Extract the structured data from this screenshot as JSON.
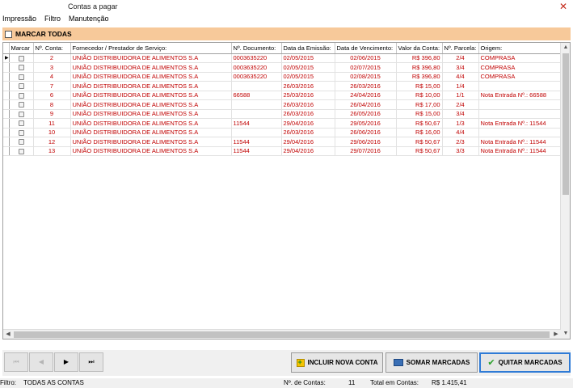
{
  "window": {
    "title": "Contas a pagar"
  },
  "menu": [
    "Impressão",
    "Filtro",
    "Manutenção"
  ],
  "marcar_todas": "MARCAR TODAS",
  "grid": {
    "columns": [
      "Marcar",
      "Nº. Conta:",
      "Fornecedor / Prestador de Serviço:",
      "Nº. Documento:",
      "Data da Emissão:",
      "Data de Vencimento:",
      "Valor da Conta:",
      "Nº. Parcela:",
      "Origem:"
    ],
    "rows": [
      {
        "conta": "2",
        "fornecedor": "UNIÃO DISTRIBUIDORA DE ALIMENTOS S.A",
        "documento": "0003635220",
        "emissao": "02/05/2015",
        "vencimento": "02/06/2015",
        "valor": "R$ 396,80",
        "parcela": "2/4",
        "origem": "COMPRASA"
      },
      {
        "conta": "3",
        "fornecedor": "UNIÃO DISTRIBUIDORA DE ALIMENTOS S.A",
        "documento": "0003635220",
        "emissao": "02/05/2015",
        "vencimento": "02/07/2015",
        "valor": "R$ 396,80",
        "parcela": "3/4",
        "origem": "COMPRASA"
      },
      {
        "conta": "4",
        "fornecedor": "UNIÃO DISTRIBUIDORA DE ALIMENTOS S.A",
        "documento": "0003635220",
        "emissao": "02/05/2015",
        "vencimento": "02/08/2015",
        "valor": "R$ 396,80",
        "parcela": "4/4",
        "origem": "COMPRASA"
      },
      {
        "conta": "7",
        "fornecedor": "UNIÃO DISTRIBUIDORA DE ALIMENTOS S.A",
        "documento": "",
        "emissao": "26/03/2016",
        "vencimento": "26/03/2016",
        "valor": "R$ 15,00",
        "parcela": "1/4",
        "origem": ""
      },
      {
        "conta": "6",
        "fornecedor": "UNIÃO DISTRIBUIDORA DE ALIMENTOS S.A",
        "documento": "66588",
        "emissao": "25/03/2016",
        "vencimento": "24/04/2016",
        "valor": "R$ 10,00",
        "parcela": "1/1",
        "origem": "Nota Entrada Nº.: 66588"
      },
      {
        "conta": "8",
        "fornecedor": "UNIÃO DISTRIBUIDORA DE ALIMENTOS S.A",
        "documento": "",
        "emissao": "26/03/2016",
        "vencimento": "26/04/2016",
        "valor": "R$ 17,00",
        "parcela": "2/4",
        "origem": ""
      },
      {
        "conta": "9",
        "fornecedor": "UNIÃO DISTRIBUIDORA DE ALIMENTOS S.A",
        "documento": "",
        "emissao": "26/03/2016",
        "vencimento": "26/05/2016",
        "valor": "R$ 15,00",
        "parcela": "3/4",
        "origem": ""
      },
      {
        "conta": "11",
        "fornecedor": "UNIÃO DISTRIBUIDORA DE ALIMENTOS S.A",
        "documento": "11544",
        "emissao": "29/04/2016",
        "vencimento": "29/05/2016",
        "valor": "R$ 50,67",
        "parcela": "1/3",
        "origem": "Nota Entrada Nº.: 11544"
      },
      {
        "conta": "10",
        "fornecedor": "UNIÃO DISTRIBUIDORA DE ALIMENTOS S.A",
        "documento": "",
        "emissao": "26/03/2016",
        "vencimento": "26/06/2016",
        "valor": "R$ 16,00",
        "parcela": "4/4",
        "origem": ""
      },
      {
        "conta": "12",
        "fornecedor": "UNIÃO DISTRIBUIDORA DE ALIMENTOS S.A",
        "documento": "11544",
        "emissao": "29/04/2016",
        "vencimento": "29/06/2016",
        "valor": "R$ 50,67",
        "parcela": "2/3",
        "origem": "Nota Entrada Nº.: 11544"
      },
      {
        "conta": "13",
        "fornecedor": "UNIÃO DISTRIBUIDORA DE ALIMENTOS S.A",
        "documento": "11544",
        "emissao": "29/04/2016",
        "vencimento": "29/07/2016",
        "valor": "R$ 50,67",
        "parcela": "3/3",
        "origem": "Nota Entrada Nº.: 11544"
      }
    ]
  },
  "nav": {
    "first": "⏮",
    "prev": "◀",
    "next": "▶",
    "last": "⏭"
  },
  "buttons": {
    "incluir": "INCLUIR NOVA CONTA",
    "somar": "SOMAR MARCADAS",
    "quitar": "QUITAR MARCADAS"
  },
  "status": {
    "filtro_label": "Filtro:",
    "filtro_value": "TODAS AS CONTAS",
    "num_label": "Nº. de Contas:",
    "num_value": "11",
    "total_label": "Total em Contas:",
    "total_value": "R$ 1.415,41"
  },
  "colors": {
    "row_text": "#c00000",
    "marcar_bar": "#f7c99a",
    "quitar_border": "#2f7bd6"
  }
}
